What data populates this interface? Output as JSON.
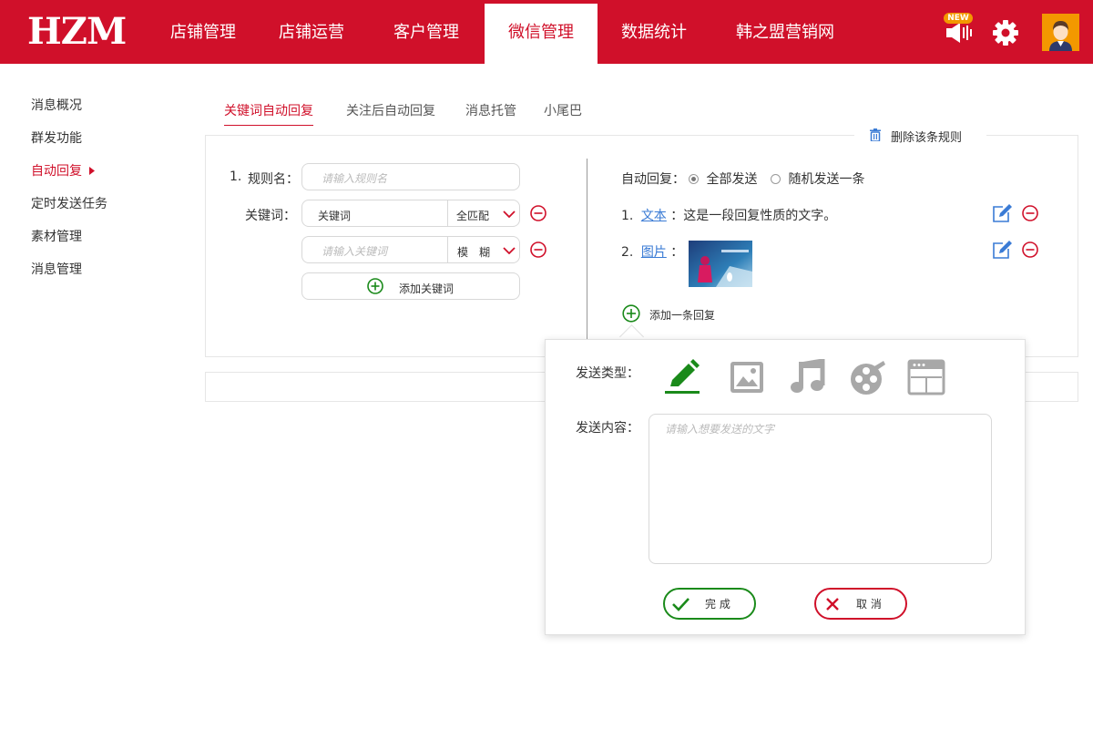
{
  "header": {
    "logo": "HZM",
    "nav": [
      {
        "label": "店铺管理"
      },
      {
        "label": "店铺运营"
      },
      {
        "label": "客户管理"
      },
      {
        "label": "微信管理"
      },
      {
        "label": "数据统计"
      },
      {
        "label": "韩之盟营销网"
      }
    ],
    "active_nav": "微信管理",
    "badge": "NEW",
    "icons": [
      "speaker-icon",
      "gear-icon",
      "avatar"
    ]
  },
  "sidebar": {
    "items": [
      {
        "label": "消息概况"
      },
      {
        "label": "群发功能"
      },
      {
        "label": "自动回复"
      },
      {
        "label": "定时发送任务"
      },
      {
        "label": "素材管理"
      },
      {
        "label": "消息管理"
      }
    ],
    "active": "自动回复"
  },
  "tabs": [
    {
      "label": "关键词自动回复"
    },
    {
      "label": "关注后自动回复"
    },
    {
      "label": "消息托管"
    },
    {
      "label": "小尾巴"
    }
  ],
  "rule": {
    "delete_label": "删除该条规则",
    "number": "1.",
    "name_label": "规则名：",
    "name_placeholder": "请输入规则名",
    "keyword_label": "关键词：",
    "keywords": [
      {
        "value": "关键词",
        "placeholder": "",
        "match": "全匹配"
      },
      {
        "value": "",
        "placeholder": "请输入关键词",
        "match": "模　糊"
      }
    ],
    "add_keyword": "添加关键词"
  },
  "reply": {
    "mode_label": "自动回复：",
    "options": [
      "全部发送",
      "随机发送一条"
    ],
    "selected": "全部发送",
    "items": [
      {
        "num": "1.",
        "type": "文本",
        "sep": "：",
        "content": "这是一段回复性质的文字。"
      },
      {
        "num": "2.",
        "type": "图片",
        "sep": "："
      }
    ],
    "add_reply": "添加一条回复"
  },
  "popup": {
    "type_label": "发送类型：",
    "types": [
      "text-icon",
      "image-icon",
      "music-icon",
      "video-icon",
      "webpage-icon"
    ],
    "selected_type": "text-icon",
    "content_label": "发送内容：",
    "content_placeholder": "请输入想要发送的文字",
    "confirm": "完 成",
    "cancel": "取 消"
  },
  "colors": {
    "brand": "#d0102a",
    "green": "#1a8a1a",
    "link": "#3a7bd5",
    "icon_gray": "#a8a8a8",
    "badge": "#f39800"
  }
}
